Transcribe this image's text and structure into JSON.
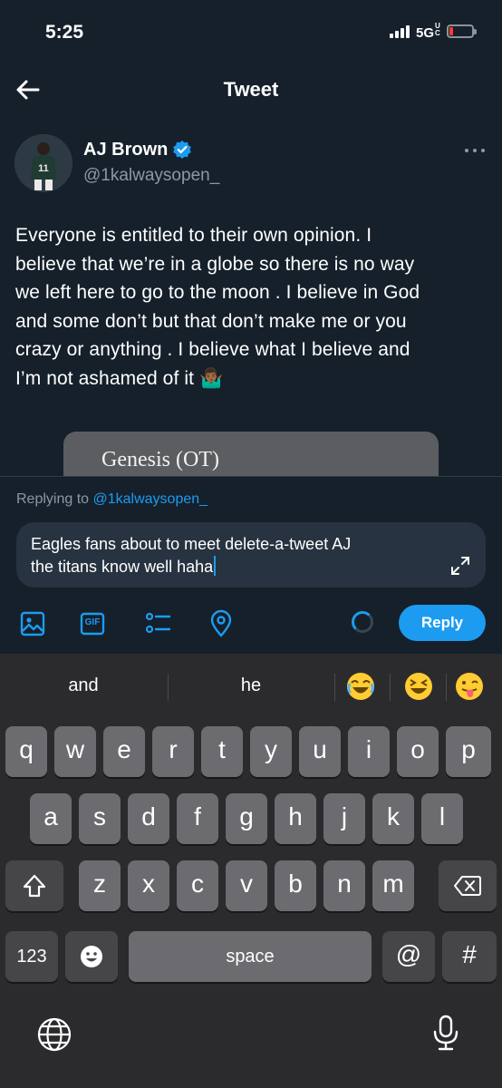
{
  "status_bar": {
    "time": "5:25",
    "network": "5G",
    "network_sup": "UC"
  },
  "header": {
    "title": "Tweet"
  },
  "tweet": {
    "author_name": "AJ Brown",
    "author_handle": "@1kalwaysopen_",
    "text_lines": [
      "Everyone is entitled to their own opinion. I",
      "believe that we’re in a globe so there is no way",
      "we left here to go to the moon .  I believe in God",
      "and some don’t but that don’t make me or you",
      "crazy or anything . I believe what I believe and",
      "I’m not ashamed of it 🤷🏾‍♂️"
    ],
    "embed_title": "Genesis (OT)"
  },
  "composer": {
    "replying_prefix": "Replying to ",
    "replying_handle": "@1kalwaysopen_",
    "reply_line1": "Eagles fans about to meet delete-a-tweet AJ",
    "reply_line2": "the titans know well haha",
    "reply_button": "Reply",
    "gif_label": "GIF"
  },
  "keyboard": {
    "suggestions": [
      "and",
      "he"
    ],
    "emoji_suggestions": [
      "joy-emoji",
      "laughing-emoji",
      "tongue-emoji"
    ],
    "row1": [
      "q",
      "w",
      "e",
      "r",
      "t",
      "y",
      "u",
      "i",
      "o",
      "p"
    ],
    "row2": [
      "a",
      "s",
      "d",
      "f",
      "g",
      "h",
      "j",
      "k",
      "l"
    ],
    "row3": [
      "z",
      "x",
      "c",
      "v",
      "b",
      "n",
      "m"
    ],
    "numbers_key": "123",
    "space_key": "space",
    "at_key": "@",
    "hash_key": "#"
  },
  "colors": {
    "background": "#15202b",
    "accent": "#1d9bf0",
    "keyboard": "#2b2b2e"
  }
}
